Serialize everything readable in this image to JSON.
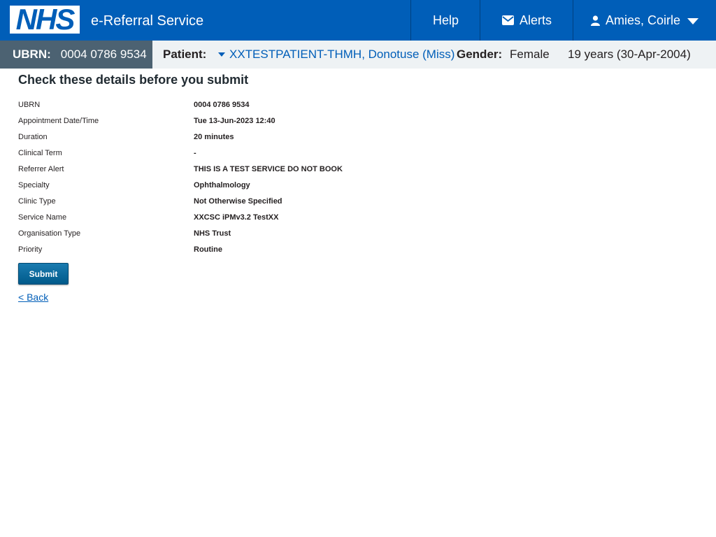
{
  "header": {
    "logo_text": "NHS",
    "service_name": "e-Referral Service",
    "help_label": "Help",
    "alerts_label": "Alerts",
    "user_label": "Amies, Coirle"
  },
  "patient_bar": {
    "ubrn_label": "UBRN:",
    "ubrn_value": "0004 0786 9534",
    "patient_label": "Patient:",
    "patient_name": "XXTESTPATIENT-THMH, Donotuse (Miss)",
    "gender_label": "Gender:",
    "gender_value": "Female",
    "age_dob": "19 years (30-Apr-2004)"
  },
  "main": {
    "title": "Check these details before you submit",
    "details": [
      {
        "label": "UBRN",
        "value": "0004 0786 9534"
      },
      {
        "label": "Appointment Date/Time",
        "value": "Tue 13-Jun-2023 12:40"
      },
      {
        "label": "Duration",
        "value": "20 minutes"
      },
      {
        "label": "Clinical Term",
        "value": "-"
      },
      {
        "label": "Referrer Alert",
        "value": "THIS IS A TEST SERVICE DO NOT BOOK"
      },
      {
        "label": "Specialty",
        "value": "Ophthalmology"
      },
      {
        "label": "Clinic Type",
        "value": "Not Otherwise Specified"
      },
      {
        "label": "Service Name",
        "value": "XXCSC iPMv3.2 TestXX"
      },
      {
        "label": "Organisation Type",
        "value": "NHS Trust"
      },
      {
        "label": "Priority",
        "value": "Routine"
      }
    ],
    "submit_label": "Submit",
    "back_label": "< Back"
  },
  "colors": {
    "header_blue": "#005eb8",
    "ubrn_box": "#4c6272",
    "patient_bar_bg": "#eef2f4",
    "link_blue": "#005eb8",
    "submit_blue": "#005a8a"
  },
  "icons": {
    "alerts": "envelope-icon",
    "user": "user-icon",
    "user_menu": "chevron-down-icon",
    "patient_toggle": "caret-down-icon"
  }
}
